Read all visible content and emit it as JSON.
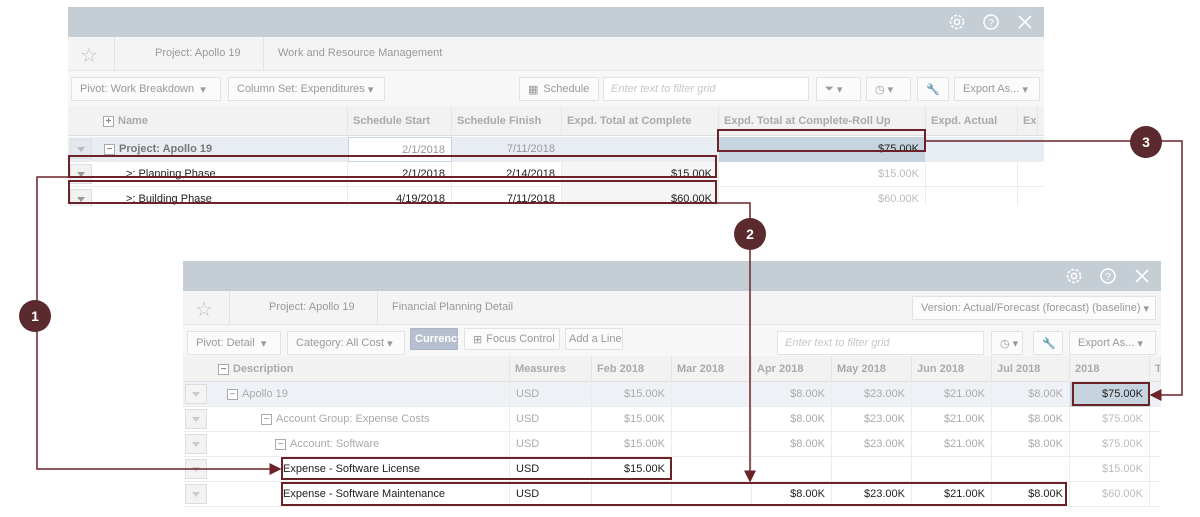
{
  "colors": {
    "accent": "#6b2229",
    "callout": "#5a2a2e",
    "title_bar": "#c6ced5",
    "currency_btn": "#b6bfd0"
  },
  "top": {
    "project": "Project: Apollo 19",
    "view": "Work and Resource Management",
    "pivot": "Pivot:  Work Breakdown",
    "column_set": "Column Set: Expenditures",
    "schedule": "Schedule",
    "filter_placeholder": "Enter text to filter grid",
    "export": "Export As...",
    "headers": [
      "Name",
      "Schedule Start",
      "Schedule Finish",
      "Expd. Total at Complete",
      "Expd. Total at Complete-Roll Up",
      "Expd. Actual",
      "Ex"
    ],
    "rows": [
      {
        "name": "Project: Apollo 19",
        "start": "2/1/2018",
        "finish": "7/11/2018",
        "total": "",
        "rollup": "$75.00K"
      },
      {
        "name": ">: Planning Phase",
        "start": "2/1/2018",
        "finish": "2/14/2018",
        "total": "$15.00K",
        "rollup": "$15.00K"
      },
      {
        "name": ">: Building Phase",
        "start": "4/19/2018",
        "finish": "7/11/2018",
        "total": "$60.00K",
        "rollup": "$60.00K"
      }
    ]
  },
  "bottom": {
    "project": "Project: Apollo 19",
    "view": "Financial Planning Detail",
    "version": "Version: Actual/Forecast (forecast) (baseline)",
    "pivot": "Pivot:  Detail",
    "category": "Category:  All Cost",
    "currency": "Currency",
    "focus": "Focus Control",
    "add_line": "Add a Line",
    "filter_placeholder": "Enter text to filter grid",
    "export": "Export As...",
    "headers": [
      "Description",
      "Measures",
      "Feb 2018",
      "Mar 2018",
      "Apr 2018",
      "May 2018",
      "Jun 2018",
      "Jul 2018",
      "2018",
      "T"
    ],
    "rows": [
      {
        "desc": "Apollo 19",
        "m": "USD",
        "v": [
          "$15.00K",
          "",
          "$8.00K",
          "$23.00K",
          "$21.00K",
          "$8.00K",
          "$75.00K"
        ]
      },
      {
        "desc": "Account Group: Expense Costs",
        "m": "USD",
        "v": [
          "$15.00K",
          "",
          "$8.00K",
          "$23.00K",
          "$21.00K",
          "$8.00K",
          "$75.00K"
        ]
      },
      {
        "desc": "Account: Software",
        "m": "USD",
        "v": [
          "$15.00K",
          "",
          "$8.00K",
          "$23.00K",
          "$21.00K",
          "$8.00K",
          "$75.00K"
        ]
      },
      {
        "desc": "Expense - Software License",
        "m": "USD",
        "v": [
          "$15.00K",
          "",
          "",
          "",
          "",
          "",
          "$15.00K"
        ]
      },
      {
        "desc": "Expense - Software Maintenance",
        "m": "USD",
        "v": [
          "",
          "",
          "$8.00K",
          "$23.00K",
          "$21.00K",
          "$8.00K",
          "$60.00K"
        ]
      }
    ]
  },
  "callouts": [
    "1",
    "2",
    "3"
  ]
}
